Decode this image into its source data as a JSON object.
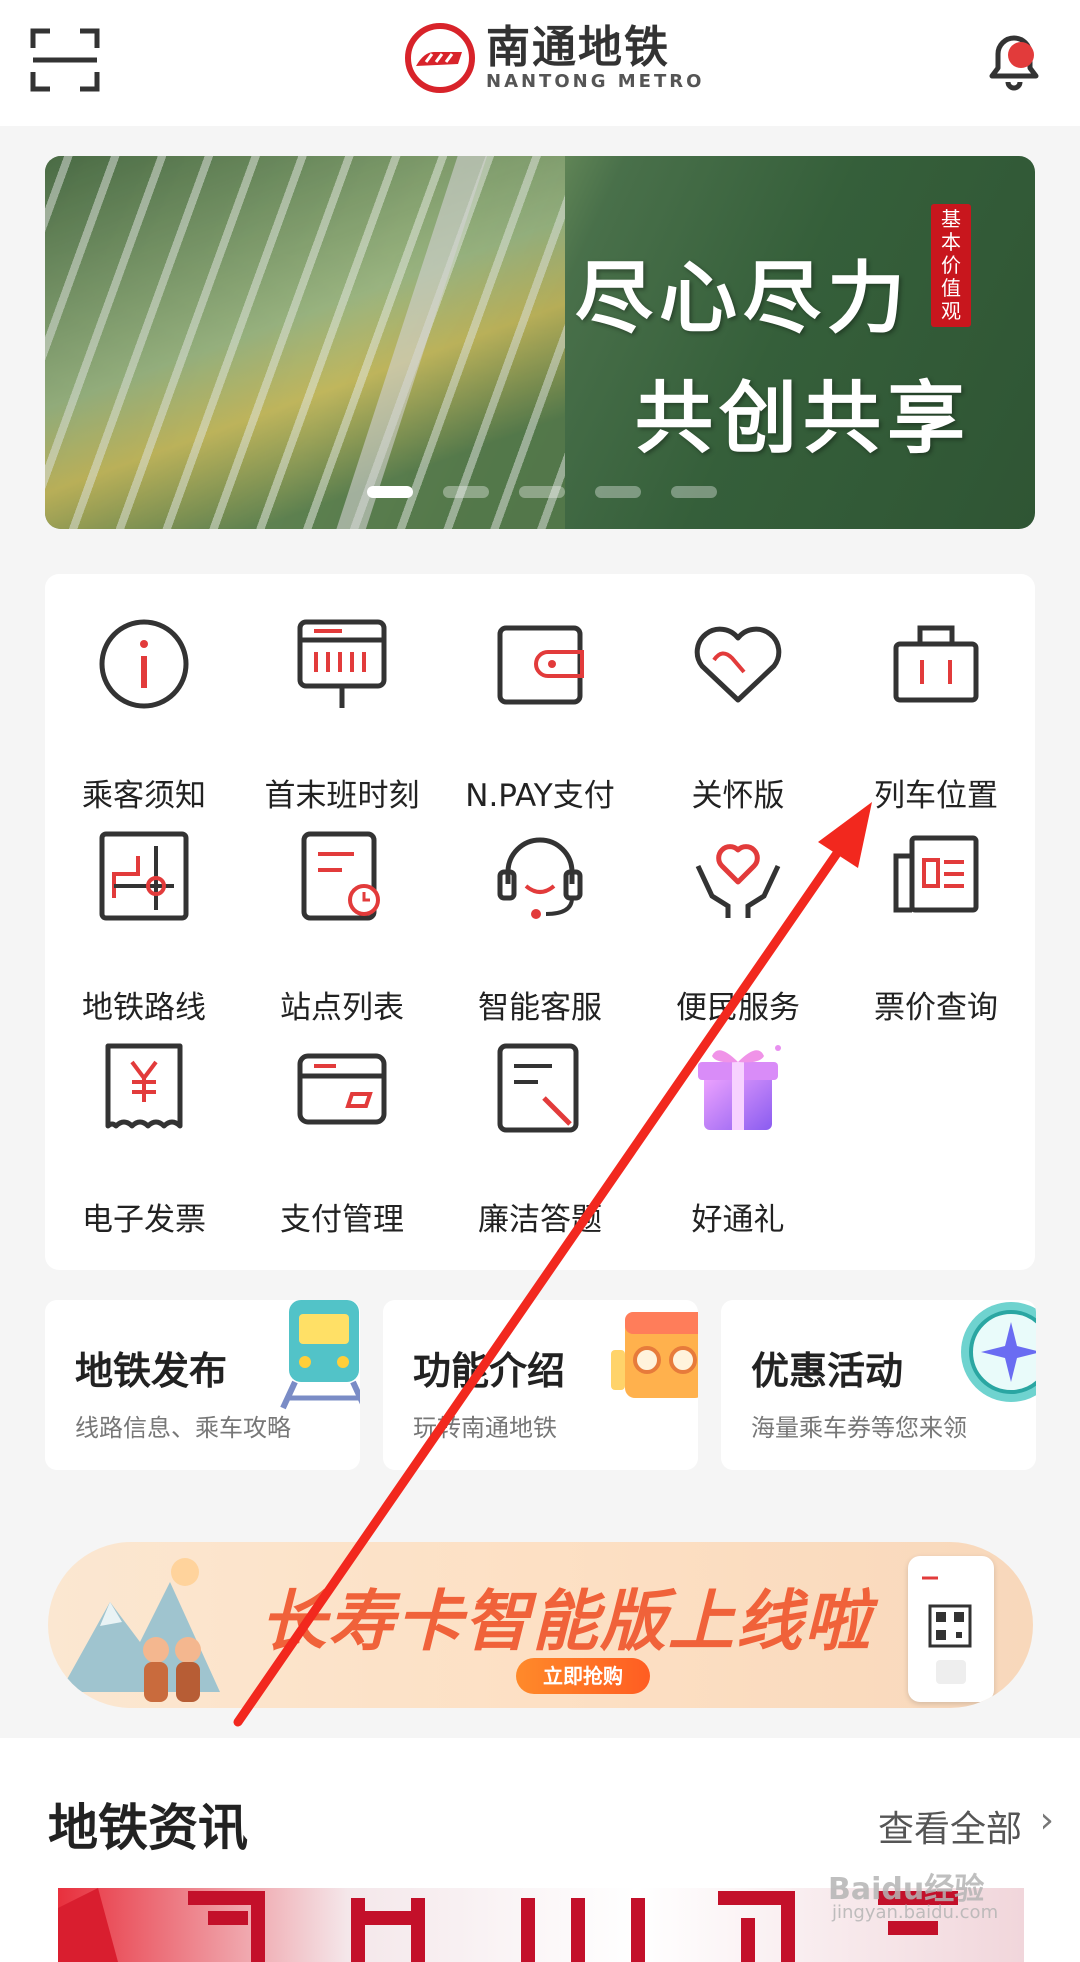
{
  "header": {
    "logo_cn": "南通地铁",
    "logo_en": "NANTONG METRO",
    "scan_icon": "scan-icon",
    "bell_icon": "bell-icon",
    "accent": "#e23b3b"
  },
  "banner": {
    "line1": "尽心尽力",
    "line2": "共创共享",
    "seal": "基本价值观",
    "active_index": 0,
    "count": 5
  },
  "grid": [
    {
      "label": "乘客须知",
      "icon": "info-icon"
    },
    {
      "label": "首末班时刻",
      "icon": "timetable-board-icon"
    },
    {
      "label": "N.PAY支付",
      "icon": "wallet-icon"
    },
    {
      "label": "关怀版",
      "icon": "heart-icon"
    },
    {
      "label": "列车位置",
      "icon": "luggage-icon"
    },
    {
      "label": "地铁路线",
      "icon": "route-map-icon"
    },
    {
      "label": "站点列表",
      "icon": "station-list-icon"
    },
    {
      "label": "智能客服",
      "icon": "headset-icon"
    },
    {
      "label": "便民服务",
      "icon": "care-hands-icon"
    },
    {
      "label": "票价查询",
      "icon": "fare-document-icon"
    },
    {
      "label": "电子发票",
      "icon": "invoice-yen-icon"
    },
    {
      "label": "支付管理",
      "icon": "card-icon"
    },
    {
      "label": "廉洁答题",
      "icon": "quiz-edit-icon"
    },
    {
      "label": "好通礼",
      "icon": "gift-box-icon"
    }
  ],
  "features": [
    {
      "title": "地铁发布",
      "sub": "线路信息、乘车攻略",
      "icon": "train-icon"
    },
    {
      "title": "功能介绍",
      "sub": "玩转南通地铁",
      "icon": "toolbox-icon"
    },
    {
      "title": "优惠活动",
      "sub": "海量乘车券等您来领",
      "icon": "compass-icon"
    }
  ],
  "promo": {
    "text": "长寿卡智能版上线啦",
    "button": "立即抢购"
  },
  "news": {
    "title": "地铁资讯",
    "more": "查看全部",
    "chevron": "›"
  },
  "watermark": {
    "brand": "Baidu经验",
    "url": "jingyan.baidu.com"
  }
}
